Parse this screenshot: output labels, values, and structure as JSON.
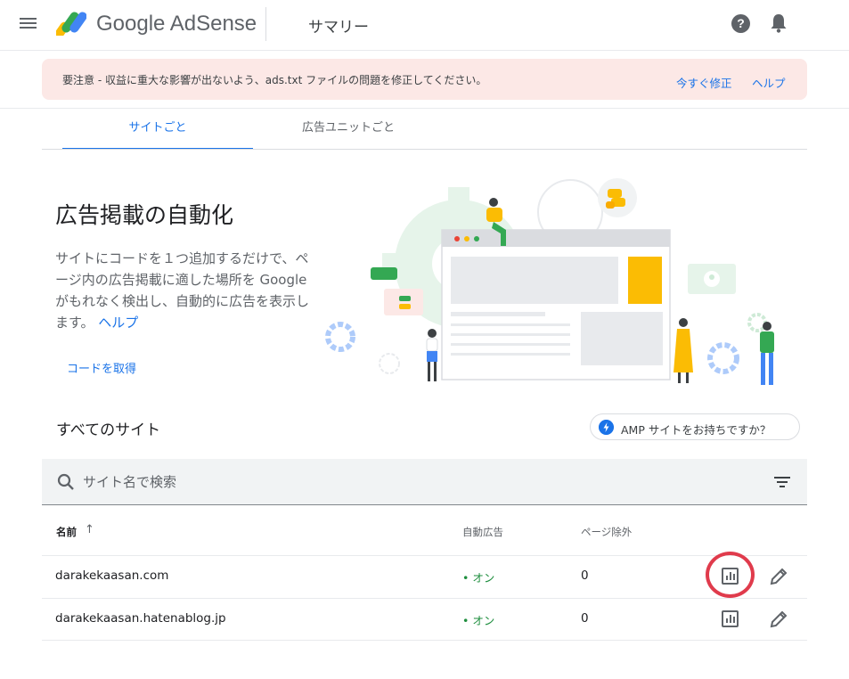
{
  "header": {
    "logo_text": "Google AdSense",
    "page_title": "サマリー",
    "help_glyph": "?",
    "icons": [
      "menu-icon",
      "adsense-logo-icon",
      "help-icon",
      "bell-icon"
    ]
  },
  "alert": {
    "message": "要注意 - 収益に重大な影響が出ないよう、ads.txt ファイルの問題を修正してください。",
    "fix_label": "今すぐ修正",
    "help_label": "ヘルプ",
    "background": "#fce8e6"
  },
  "tabs": [
    {
      "label": "サイトごと",
      "active": true
    },
    {
      "label": "広告ユニットごと",
      "active": false
    }
  ],
  "auto_ads": {
    "title": "広告掲載の自動化",
    "description": "サイトにコードを１つ追加するだけで、ページ内の広告掲載に適した場所を Google がもれなく検出し、自動的に広告を表示します。",
    "help_label": "ヘルプ",
    "get_code_label": "コードを取得"
  },
  "sites": {
    "title": "すべてのサイト",
    "amp_chip_label": "AMP サイトをお持ちですか？",
    "search_placeholder": "サイト名で検索",
    "columns": {
      "name": "名前",
      "sort_arrow": "↑",
      "auto_ads": "自動広告",
      "page_exclusions": "ページ除外"
    },
    "rows": [
      {
        "name": "darakekaasan.com",
        "status": "• オン",
        "exclusions": "0",
        "highlighted": true
      },
      {
        "name": "darakekaasan.hatenablog.jp",
        "status": "• オン",
        "exclusions": "0",
        "highlighted": false
      }
    ]
  },
  "colors": {
    "accent": "#1a73e8",
    "status_on": "#1e8e3e",
    "highlight_ring": "#e03b4c"
  }
}
